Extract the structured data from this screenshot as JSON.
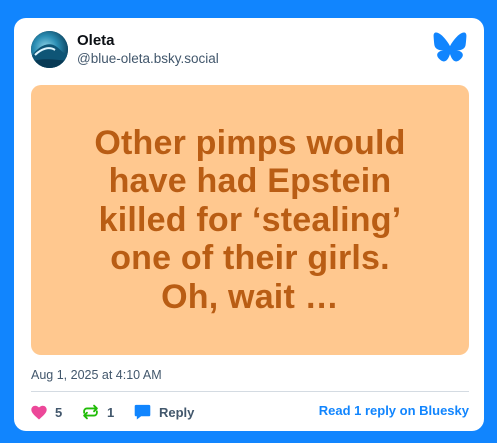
{
  "author": {
    "display_name": "Oleta",
    "handle": "@blue-oleta.bsky.social",
    "avatar_icon": "wave-avatar"
  },
  "post": {
    "image_text": "Other pimps would\nhave had Epstein\nkilled for ‘stealing’\none of their girls.\nOh, wait …",
    "image_background": "#ffc88f",
    "image_text_color": "#b95d14",
    "timestamp": "Aug 1, 2025 at 4:10 AM"
  },
  "actions": {
    "likes": "5",
    "reposts": "1",
    "reply_label": "Reply",
    "read_link": "Read 1 reply on Bluesky"
  },
  "colors": {
    "brand": "#1185fe",
    "like": "#ec4899",
    "repost": "#20bc07"
  }
}
